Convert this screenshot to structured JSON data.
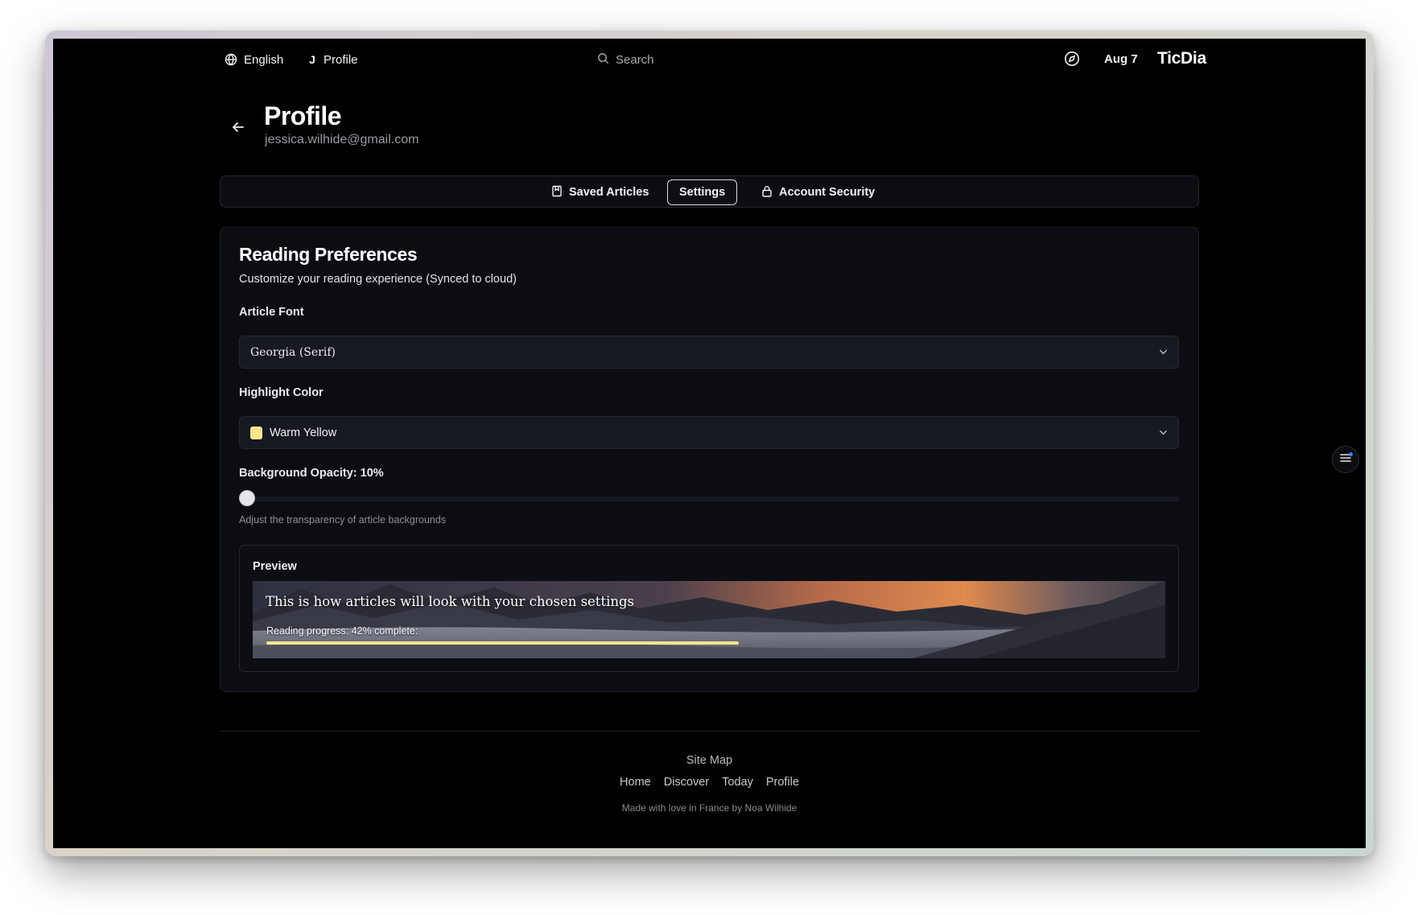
{
  "topnav": {
    "language": "English",
    "profile_initial": "J",
    "profile_label": "Profile",
    "search_placeholder": "Search",
    "date": "Aug 7",
    "brand": "TicDia"
  },
  "header": {
    "title": "Profile",
    "email": "jessica.wilhide@gmail.com"
  },
  "tabs": [
    {
      "label": "Saved Articles",
      "icon": "bookmark-icon",
      "active": false
    },
    {
      "label": "Settings",
      "icon": "",
      "active": true
    },
    {
      "label": "Account Security",
      "icon": "lock-icon",
      "active": false
    }
  ],
  "preferences": {
    "title": "Reading Preferences",
    "subtitle": "Customize your reading experience (Synced to cloud)",
    "font_label": "Article Font",
    "font_value": "Georgia (Serif)",
    "highlight_label": "Highlight Color",
    "highlight_value": "Warm Yellow",
    "highlight_color": "#fde68a",
    "opacity_label": "Background Opacity: 10%",
    "opacity_value": 0.1,
    "opacity_hint": "Adjust the transparency of article backgrounds"
  },
  "preview": {
    "label": "Preview",
    "sample_text": "This is how articles will look with your chosen settings",
    "progress_label": "Reading progress: 42% complete:",
    "progress_value": 0.42
  },
  "footer": {
    "title": "Site Map",
    "links": [
      "Home",
      "Discover",
      "Today",
      "Profile"
    ],
    "credit": "Made with love in France by Noa Wilhide"
  },
  "colors": {
    "background": "#000000",
    "card": "#0b0d12",
    "accent_highlight": "#fde68a",
    "notification_dot": "#3b82f6"
  }
}
